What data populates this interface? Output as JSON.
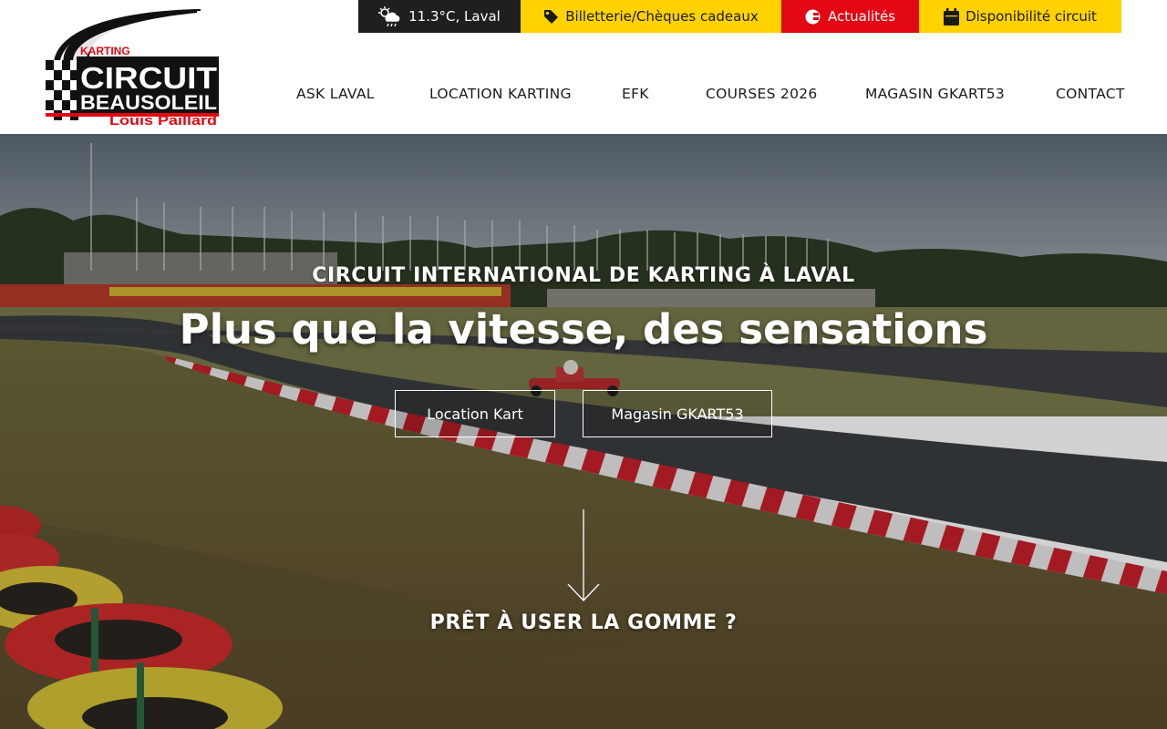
{
  "topbar": {
    "weather": {
      "icon": "cloud-sun-rain-icon",
      "label": "11.3°C, Laval"
    },
    "ticketing": {
      "icon": "tag-icon",
      "label": "Billetterie/Chèques cadeaux"
    },
    "news": {
      "icon": "news-icon",
      "label": "Actualités"
    },
    "availability": {
      "icon": "calendar-icon",
      "label": "Disponibilité circuit"
    }
  },
  "logo": {
    "line1": "KARTING",
    "line2": "CIRCUIT",
    "line3": "BEAUSOLEIL",
    "line4": "Louis Paillard"
  },
  "nav": {
    "items": [
      {
        "label": "ASK LAVAL"
      },
      {
        "label": "LOCATION KARTING"
      },
      {
        "label": "EFK"
      },
      {
        "label": "COURSES 2026"
      },
      {
        "label": "MAGASIN GKART53"
      },
      {
        "label": "CONTACT"
      }
    ]
  },
  "hero": {
    "subtitle": "CIRCUIT INTERNATIONAL DE KARTING À LAVAL",
    "title": "Plus que la vitesse, des sensations",
    "button_kart": "Location Kart",
    "button_shop": "Magasin GKART53",
    "scroll_icon": "arrow-down-icon",
    "cta": "PRÊT À USER LA GOMME ?"
  },
  "colors": {
    "yellow": "#ffd200",
    "red": "#e30613",
    "dark": "#1f1f1f"
  }
}
